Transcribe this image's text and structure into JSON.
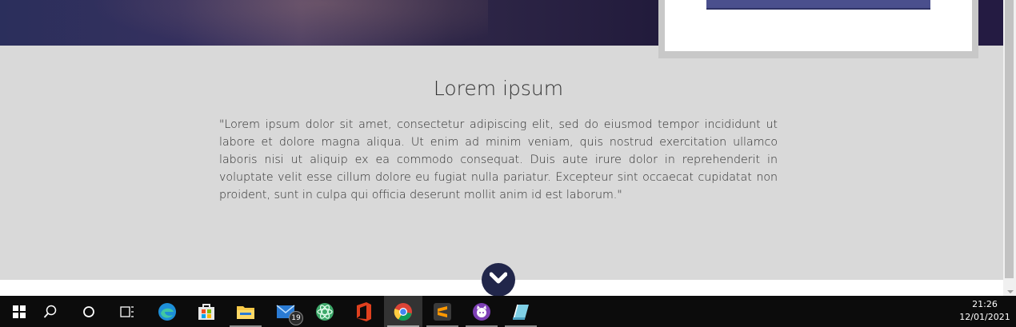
{
  "content": {
    "title": "Lorem ipsum",
    "paragraph": "\"Lorem ipsum dolor sit amet, consectetur adipiscing elit, sed do eiusmod tempor incididunt ut labore et dolore magna aliqua. Ut enim ad minim veniam, quis nostrud exercitation ullamco laboris nisi ut aliquip ex ea commodo consequat. Duis aute irure dolor in reprehenderit in voluptate velit esse cillum dolore eu fugiat nulla pariatur. Excepteur sint occaecat cupidatat non proident, sunt in culpa qui officia deserunt mollit anim id est laborum.\""
  },
  "colors": {
    "page_bg": "#d9d9d9",
    "accent_dark": "#21264a",
    "taskbar_bg": "#0c0c0c"
  },
  "taskbar": {
    "items": [
      {
        "name": "windows-start-icon"
      },
      {
        "name": "search-icon"
      },
      {
        "name": "cortana-icon"
      },
      {
        "name": "task-view-icon"
      },
      {
        "name": "edge-icon"
      },
      {
        "name": "microsoft-store-icon"
      },
      {
        "name": "file-explorer-icon"
      },
      {
        "name": "mail-icon",
        "badge": "19"
      },
      {
        "name": "atom-icon"
      },
      {
        "name": "office-icon"
      },
      {
        "name": "chrome-icon"
      },
      {
        "name": "sublime-text-icon"
      },
      {
        "name": "github-desktop-icon"
      },
      {
        "name": "notepad-icon"
      }
    ],
    "clock": {
      "time": "21:26",
      "date": "12/01/2021"
    }
  }
}
